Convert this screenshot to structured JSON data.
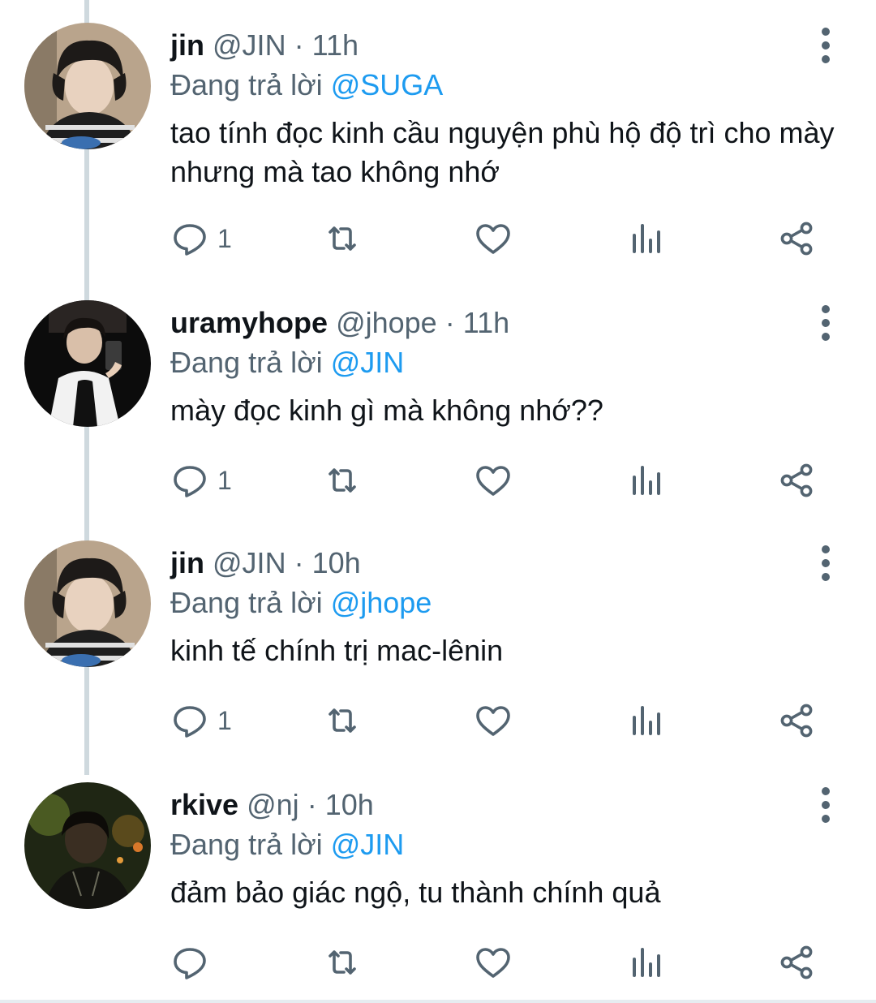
{
  "reply_prefix": "Đang trả lời",
  "colors": {
    "mention": "#1d9bf0",
    "secondary_text": "#536471",
    "thread_line": "#cfd9de"
  },
  "tweets": [
    {
      "name": "jin",
      "handle": "@JIN",
      "dot": "·",
      "time": "11h",
      "mention": "@SUGA",
      "text": "tao tính đọc kinh cầu nguyện phù hộ độ trì cho mày nhưng mà tao không nhớ",
      "reply_count": "1",
      "avatar_icon": "avatar-photo-jin"
    },
    {
      "name": "uramyhope",
      "handle": "@jhope",
      "dot": "·",
      "time": "11h",
      "mention": "@JIN",
      "text": "mày đọc kinh gì mà không nhớ??",
      "reply_count": "1",
      "avatar_icon": "avatar-photo-uramyhope"
    },
    {
      "name": "jin",
      "handle": "@JIN",
      "dot": "·",
      "time": "10h",
      "mention": "@jhope",
      "text": "kinh tế chính trị mac-lênin",
      "reply_count": "1",
      "avatar_icon": "avatar-photo-jin"
    },
    {
      "name": "rkive",
      "handle": "@nj",
      "dot": "·",
      "time": "10h",
      "mention": "@JIN",
      "text": "đảm bảo giác ngộ, tu thành chính quả",
      "reply_count": "",
      "avatar_icon": "avatar-photo-rkive"
    }
  ],
  "action_icons": [
    "reply-icon",
    "retweet-icon",
    "like-icon",
    "analytics-icon",
    "share-icon"
  ]
}
